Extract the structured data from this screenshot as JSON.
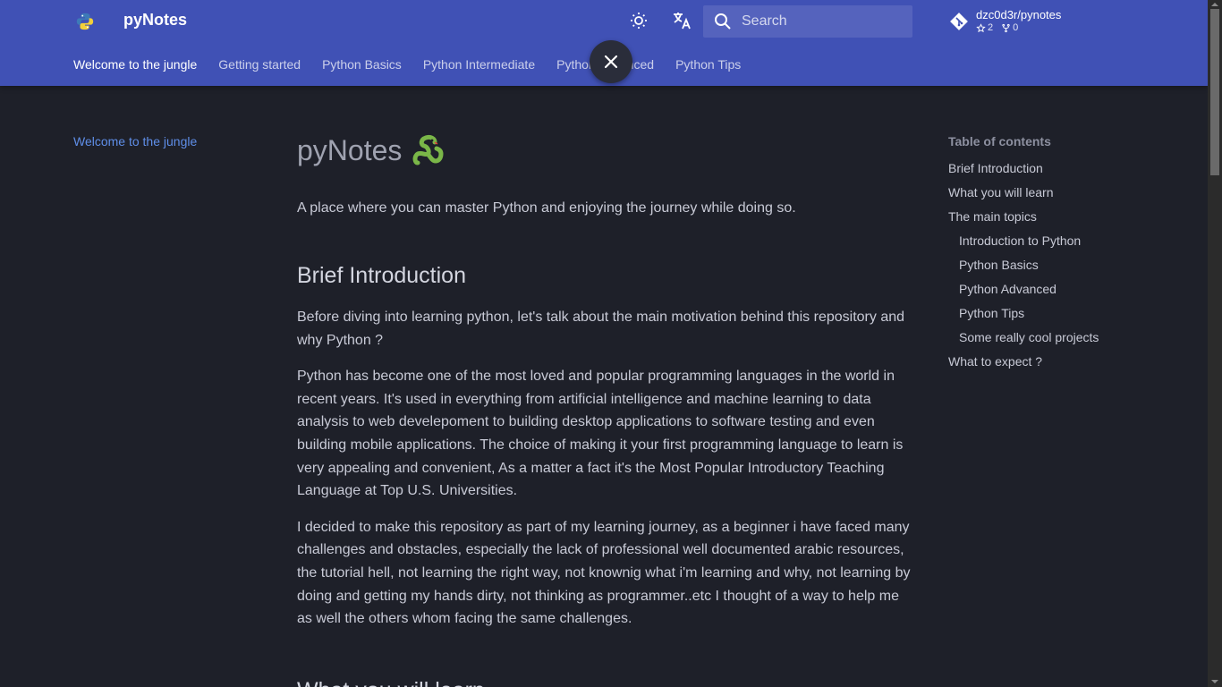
{
  "header": {
    "title": "pyNotes",
    "logo_icon": "python-logo-icon",
    "theme_toggle_icon": "brightness-icon",
    "translate_icon": "translate-icon",
    "search": {
      "placeholder": "Search",
      "value": ""
    },
    "repo": {
      "name": "dzc0d3r/pynotes",
      "stars": "2",
      "forks": "0"
    },
    "close_icon": "close-icon"
  },
  "tabs": [
    {
      "label": "Welcome to the jungle",
      "active": true
    },
    {
      "label": "Getting started"
    },
    {
      "label": "Python Basics"
    },
    {
      "label": "Python Intermediate"
    },
    {
      "label": "Python Advanced"
    },
    {
      "label": "Python Tips"
    }
  ],
  "left_nav": [
    {
      "label": "Welcome to the jungle"
    }
  ],
  "main": {
    "title": "pyNotes",
    "lead": "A place where you can master Python and enjoying the journey while doing so.",
    "section1": {
      "heading": "Brief Introduction",
      "paragraphs": [
        "Before diving into learning python, let's talk about the main motivation behind this repository and why Python ?",
        "Python has become one of the most loved and popular programming languages in the world in recent years. It's used in everything from artificial intelligence and machine learning to data analysis to web develepoment to building desktop applications to software testing and even building mobile applications. The choice of making it your first programming language to learn is very appealing and convenient, As a matter a fact it's the Most Popular Introductory Teaching Language at Top U.S. Universities.",
        "I decided to make this repository as part of my learning journey, as a beginner i have faced many challenges and obstacles, especially the lack of professional well documented arabic resources, the tutorial hell, not learning the right way, not knownig what i'm learning and why, not learning by doing and getting my hands dirty, not thinking as programmer..etc I thought of a way to help me as well the others whom facing the same challenges."
      ]
    },
    "section2": {
      "heading": "What you will learn"
    }
  },
  "toc": {
    "title": "Table of contents",
    "items": [
      {
        "label": "Brief Introduction"
      },
      {
        "label": "What you will learn"
      },
      {
        "label": "The main topics"
      },
      {
        "label": "Introduction to Python"
      },
      {
        "label": "Python Basics"
      },
      {
        "label": "Python Advanced"
      },
      {
        "label": "Python Tips"
      },
      {
        "label": "Some really cool projects"
      },
      {
        "label": "What to expect ?"
      }
    ]
  },
  "colors": {
    "header_bg": "#4051b5",
    "page_bg": "#1e2029",
    "link": "#5f8ee8"
  }
}
